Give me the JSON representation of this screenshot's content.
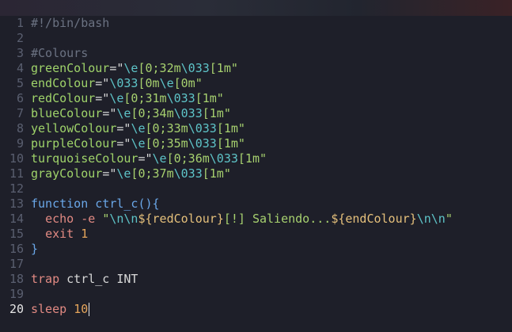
{
  "editor": {
    "lines": [
      {
        "n": "1",
        "tokens": [
          {
            "t": "#!/bin/bash",
            "c": "cmt"
          }
        ]
      },
      {
        "n": "2",
        "tokens": []
      },
      {
        "n": "3",
        "tokens": [
          {
            "t": "#Colours",
            "c": "cmt"
          }
        ]
      },
      {
        "n": "4",
        "tokens": [
          {
            "t": "greenColour",
            "c": "var"
          },
          {
            "t": "=\"",
            "c": "op"
          },
          {
            "t": "\\e",
            "c": "esc"
          },
          {
            "t": "[0;32m",
            "c": "str"
          },
          {
            "t": "\\033",
            "c": "esc"
          },
          {
            "t": "[1m\"",
            "c": "str"
          }
        ]
      },
      {
        "n": "5",
        "tokens": [
          {
            "t": "endColour",
            "c": "var"
          },
          {
            "t": "=\"",
            "c": "op"
          },
          {
            "t": "\\033",
            "c": "esc"
          },
          {
            "t": "[0m",
            "c": "str"
          },
          {
            "t": "\\e",
            "c": "esc"
          },
          {
            "t": "[0m\"",
            "c": "str"
          }
        ]
      },
      {
        "n": "6",
        "tokens": [
          {
            "t": "redColour",
            "c": "var"
          },
          {
            "t": "=\"",
            "c": "op"
          },
          {
            "t": "\\e",
            "c": "esc"
          },
          {
            "t": "[0;31m",
            "c": "str"
          },
          {
            "t": "\\033",
            "c": "esc"
          },
          {
            "t": "[1m\"",
            "c": "str"
          }
        ]
      },
      {
        "n": "7",
        "tokens": [
          {
            "t": "blueColour",
            "c": "var"
          },
          {
            "t": "=\"",
            "c": "op"
          },
          {
            "t": "\\e",
            "c": "esc"
          },
          {
            "t": "[0;34m",
            "c": "str"
          },
          {
            "t": "\\033",
            "c": "esc"
          },
          {
            "t": "[1m\"",
            "c": "str"
          }
        ]
      },
      {
        "n": "8",
        "tokens": [
          {
            "t": "yellowColour",
            "c": "var"
          },
          {
            "t": "=\"",
            "c": "op"
          },
          {
            "t": "\\e",
            "c": "esc"
          },
          {
            "t": "[0;33m",
            "c": "str"
          },
          {
            "t": "\\033",
            "c": "esc"
          },
          {
            "t": "[1m\"",
            "c": "str"
          }
        ]
      },
      {
        "n": "9",
        "tokens": [
          {
            "t": "purpleColour",
            "c": "var"
          },
          {
            "t": "=\"",
            "c": "op"
          },
          {
            "t": "\\e",
            "c": "esc"
          },
          {
            "t": "[0;35m",
            "c": "str"
          },
          {
            "t": "\\033",
            "c": "esc"
          },
          {
            "t": "[1m\"",
            "c": "str"
          }
        ]
      },
      {
        "n": "10",
        "tokens": [
          {
            "t": "turquoiseColour",
            "c": "var"
          },
          {
            "t": "=\"",
            "c": "op"
          },
          {
            "t": "\\e",
            "c": "esc"
          },
          {
            "t": "[0;36m",
            "c": "str"
          },
          {
            "t": "\\033",
            "c": "esc"
          },
          {
            "t": "[1m\"",
            "c": "str"
          }
        ]
      },
      {
        "n": "11",
        "tokens": [
          {
            "t": "grayColour",
            "c": "var"
          },
          {
            "t": "=\"",
            "c": "op"
          },
          {
            "t": "\\e",
            "c": "esc"
          },
          {
            "t": "[0;37m",
            "c": "str"
          },
          {
            "t": "\\033",
            "c": "esc"
          },
          {
            "t": "[1m\"",
            "c": "str"
          }
        ]
      },
      {
        "n": "12",
        "tokens": []
      },
      {
        "n": "13",
        "tokens": [
          {
            "t": "function",
            "c": "fn"
          },
          {
            "t": " ",
            "c": "plain"
          },
          {
            "t": "ctrl_c",
            "c": "fn"
          },
          {
            "t": "(){",
            "c": "fn"
          }
        ]
      },
      {
        "n": "14",
        "tokens": [
          {
            "t": "  ",
            "c": "plain"
          },
          {
            "t": "echo",
            "c": "sh"
          },
          {
            "t": " -e ",
            "c": "sh"
          },
          {
            "t": "\"",
            "c": "str"
          },
          {
            "t": "\\n\\n",
            "c": "esc"
          },
          {
            "t": "${",
            "c": "id"
          },
          {
            "t": "redColour",
            "c": "id"
          },
          {
            "t": "}",
            "c": "id"
          },
          {
            "t": "[!] Saliendo...",
            "c": "str"
          },
          {
            "t": "${",
            "c": "id"
          },
          {
            "t": "endColour",
            "c": "id"
          },
          {
            "t": "}",
            "c": "id"
          },
          {
            "t": "\\n\\n",
            "c": "esc"
          },
          {
            "t": "\"",
            "c": "str"
          }
        ]
      },
      {
        "n": "15",
        "tokens": [
          {
            "t": "  ",
            "c": "plain"
          },
          {
            "t": "exit",
            "c": "sh"
          },
          {
            "t": " ",
            "c": "plain"
          },
          {
            "t": "1",
            "c": "num"
          }
        ]
      },
      {
        "n": "16",
        "tokens": [
          {
            "t": "}",
            "c": "fn"
          }
        ]
      },
      {
        "n": "17",
        "tokens": []
      },
      {
        "n": "18",
        "tokens": [
          {
            "t": "trap",
            "c": "sh"
          },
          {
            "t": " ctrl_c INT",
            "c": "plain"
          }
        ]
      },
      {
        "n": "19",
        "tokens": []
      },
      {
        "n": "20",
        "tokens": [
          {
            "t": "sleep",
            "c": "sh"
          },
          {
            "t": " ",
            "c": "plain"
          },
          {
            "t": "10",
            "c": "num"
          }
        ],
        "current": true
      }
    ]
  },
  "colors": {
    "background": "#1e1f29",
    "line_number": "#5a5f70",
    "current_line_number": "#e6e6e6"
  }
}
